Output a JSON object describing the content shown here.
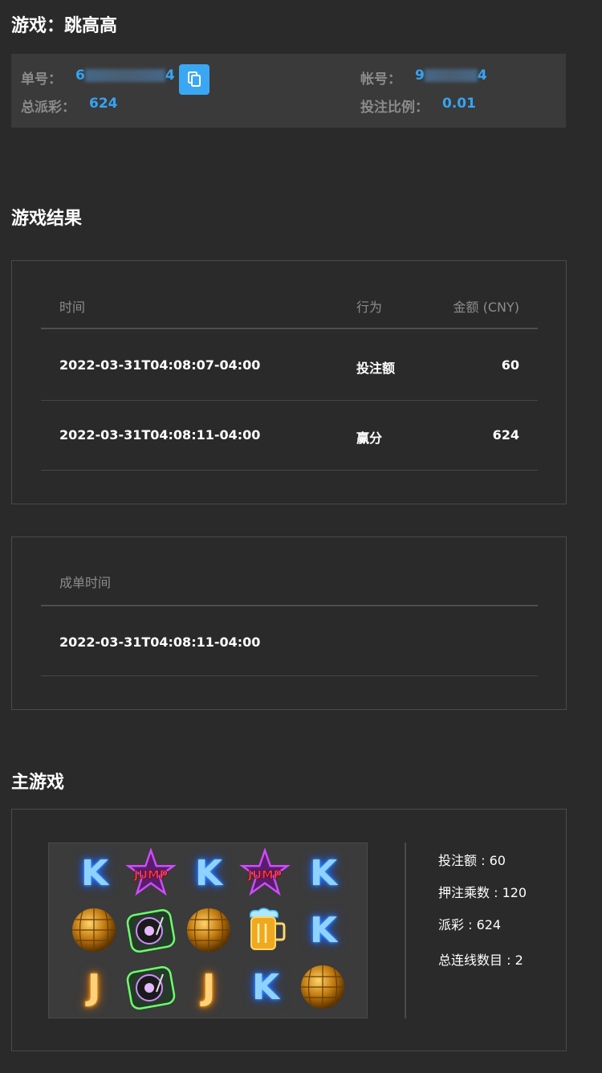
{
  "header": {
    "title": "游戏：跳高高"
  },
  "order": {
    "order_no_label": "单号：",
    "order_no_start": "6",
    "order_no_end": "4",
    "account_label": "帐号：",
    "account_start": "9",
    "account_end": "4",
    "total_payout_label": "总派彩：",
    "total_payout_value": "624",
    "bet_ratio_label": "投注比例：",
    "bet_ratio_value": "0.01"
  },
  "results": {
    "title": "游戏结果",
    "columns": [
      "时间",
      "行为",
      "金额 (CNY)"
    ],
    "rows": [
      {
        "time": "2022-03-31T04:08:07-04:00",
        "action": "投注额",
        "amount": "60"
      },
      {
        "time": "2022-03-31T04:08:11-04:00",
        "action": "赢分",
        "amount": "624"
      }
    ],
    "completion_header": "成单时间",
    "completion_time": "2022-03-31T04:08:11-04:00"
  },
  "main_game": {
    "title": "主游戏",
    "reels": [
      [
        "K",
        "JUMP",
        "K",
        "JUMP",
        "K"
      ],
      [
        "DISCO",
        "TURNTABLE",
        "DISCO",
        "BEER",
        "K"
      ],
      [
        "J",
        "TURNTABLE",
        "J",
        "K",
        "DISCO"
      ]
    ],
    "symbol_labels": {
      "jump": "JUMP"
    },
    "stats": {
      "bet": "投注额 : 60",
      "multiplier": "押注乘数 : 120",
      "payout": "派彩 : 624",
      "lines": "总连线数目 : 2"
    }
  },
  "colors": {
    "background": "#2a2a2a",
    "accent": "#35a4f2",
    "copy_button": "#3aa7f4",
    "label_gray": "#8b8b8b"
  },
  "icons": {
    "copy": "copy-icon"
  }
}
